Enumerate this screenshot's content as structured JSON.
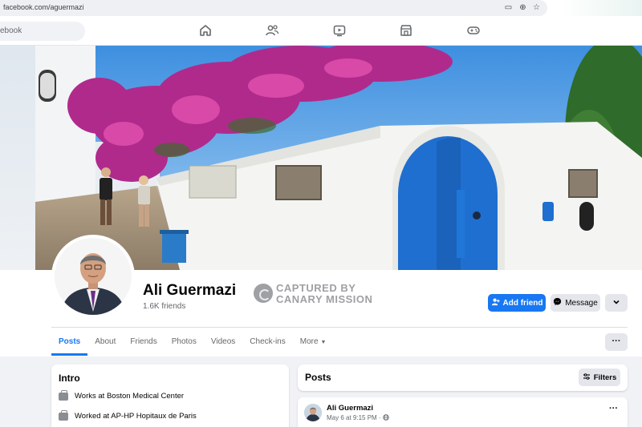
{
  "browser": {
    "url": "facebook.com/aguermazi"
  },
  "topnav": {
    "search_text": "ebook",
    "icons": [
      "home-icon",
      "friends-icon",
      "video-icon",
      "marketplace-icon",
      "gaming-icon"
    ]
  },
  "profile": {
    "name": "Ali Guermazi",
    "friends": "1.6K friends"
  },
  "watermark": {
    "line1": "CAPTURED BY",
    "line2": "CANARY MISSION"
  },
  "actions": {
    "add_friend": "Add friend",
    "message": "Message"
  },
  "tabs": [
    "Posts",
    "About",
    "Friends",
    "Photos",
    "Videos",
    "Check-ins",
    "More"
  ],
  "intro": {
    "title": "Intro",
    "items": [
      "Works at Boston Medical Center",
      "Worked at AP-HP Hopitaux de Paris"
    ]
  },
  "posts": {
    "title": "Posts",
    "filters_label": "Filters",
    "first_post": {
      "author": "Ali Guermazi",
      "time": "May 6 at 9:15 PM · "
    }
  },
  "colors": {
    "accent": "#1877f2",
    "door": "#1e6fd0",
    "bougainvillea": "#b02a8c"
  }
}
